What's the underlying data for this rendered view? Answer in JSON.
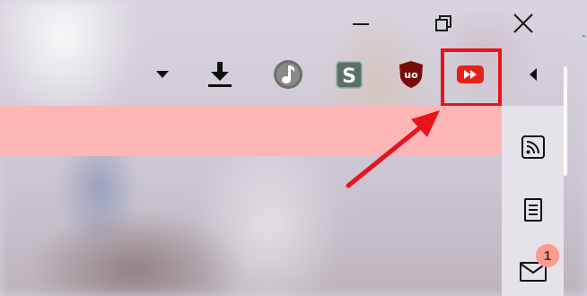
{
  "window_controls": {
    "minimize_icon": "minimize-icon",
    "restore_icon": "restore-icon",
    "close_icon": "close-icon"
  },
  "toolbar": {
    "items": [
      {
        "name": "menu-dropdown",
        "icon": "caret-down-icon"
      },
      {
        "name": "downloads",
        "icon": "download-icon"
      },
      {
        "name": "music-extension",
        "icon": "music-note-icon"
      },
      {
        "name": "s-extension",
        "icon": "s-logo-icon"
      },
      {
        "name": "ublock-origin",
        "icon": "ublock-shield-icon"
      },
      {
        "name": "youtube-fast-forward-extension",
        "icon": "fast-forward-icon"
      },
      {
        "name": "collapse-extensions",
        "icon": "caret-left-icon"
      }
    ]
  },
  "sidebar": {
    "items": [
      {
        "name": "rss-feed",
        "icon": "rss-icon"
      },
      {
        "name": "reading-list",
        "icon": "document-icon"
      },
      {
        "name": "mail",
        "icon": "mail-icon",
        "badge": "1"
      }
    ]
  },
  "colors": {
    "highlight": "#e8141b",
    "band": "#ffb6b7",
    "youtube_red": "#e62117"
  }
}
